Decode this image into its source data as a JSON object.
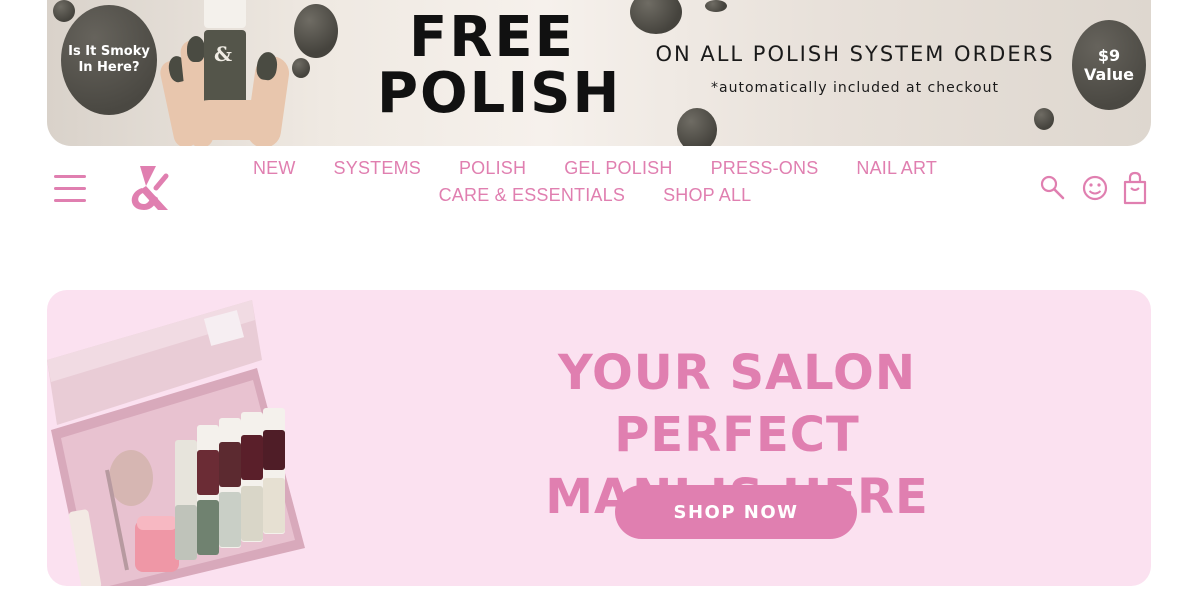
{
  "colors": {
    "brand_pink": "#e07fb0",
    "hero_bg": "#fbe1f0",
    "banner_dark": "#4a4842"
  },
  "promo": {
    "left_badge": {
      "line1": "Is It Smoky",
      "line2": "In Here?"
    },
    "headline": {
      "line1": "FREE",
      "line2": "POLISH"
    },
    "offer_text": "ON ALL POLISH SYSTEM ORDERS",
    "offer_note": "*automatically included at checkout",
    "value_badge": {
      "line1": "$9",
      "line2": "Value"
    },
    "bottle_mark": "&"
  },
  "nav": {
    "menu_icon": "hamburger-icon",
    "logo": "ampersand-logo",
    "links": [
      "NEW",
      "SYSTEMS",
      "POLISH",
      "GEL POLISH",
      "PRESS-ONS",
      "NAIL ART",
      "CARE & ESSENTIALS",
      "SHOP ALL"
    ],
    "icons": [
      "search-icon",
      "account-icon",
      "bag-icon"
    ]
  },
  "hero": {
    "title_line1": "YOUR SALON PERFECT",
    "title_line2": "MANI IS HERE",
    "cta": "SHOP NOW"
  }
}
